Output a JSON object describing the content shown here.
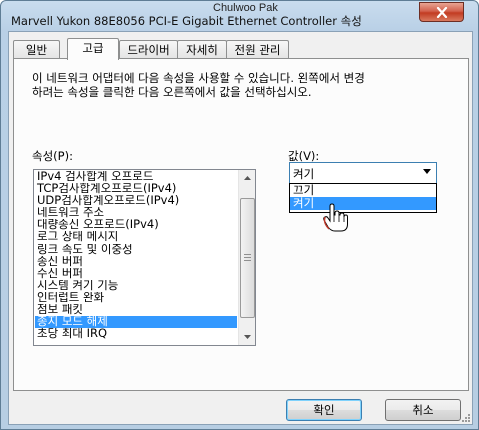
{
  "window": {
    "title": "Marvell Yukon 88E8056 PCI-E Gigabit Ethernet Controller 속성",
    "watermark": "Chulwoo Pak"
  },
  "tabs": [
    {
      "label": "일반"
    },
    {
      "label": "고급"
    },
    {
      "label": "드라이버"
    },
    {
      "label": "자세히"
    },
    {
      "label": "전원 관리"
    }
  ],
  "active_tab": "고급",
  "description": "이 네트워크 어댑터에 다음 속성을 사용할 수 있습니다. 왼쪽에서 변경\n하려는 속성을 클릭한 다음 오른쪽에서 값을 선택하십시오.",
  "property_label": "속성(P):",
  "value_label": "값(V):",
  "properties": [
    "IPv4 검사합계 오프로드",
    "TCP검사합계오프로드(IPv4)",
    "UDP검사합계오프로드(IPv4)",
    "네트워크 주소",
    "대량송신 오프로드(IPv4)",
    "로그 상태 메시지",
    "링크 속도 및 이중성",
    "송신 버퍼",
    "수신 버퍼",
    "시스템 켜기 기능",
    "인터럽트 완화",
    "점보 패킷",
    "종지 모드 해제",
    "초당 최대 IRQ"
  ],
  "selected_property": "종지 모드 해제",
  "value_combo": {
    "selected": "켜기",
    "options": [
      "끄기",
      "켜기"
    ],
    "highlighted": "켜기"
  },
  "buttons": {
    "ok": "확인",
    "cancel": "취소"
  },
  "icons": {
    "close": "close-icon",
    "cursor": "hand-pointer-icon"
  }
}
